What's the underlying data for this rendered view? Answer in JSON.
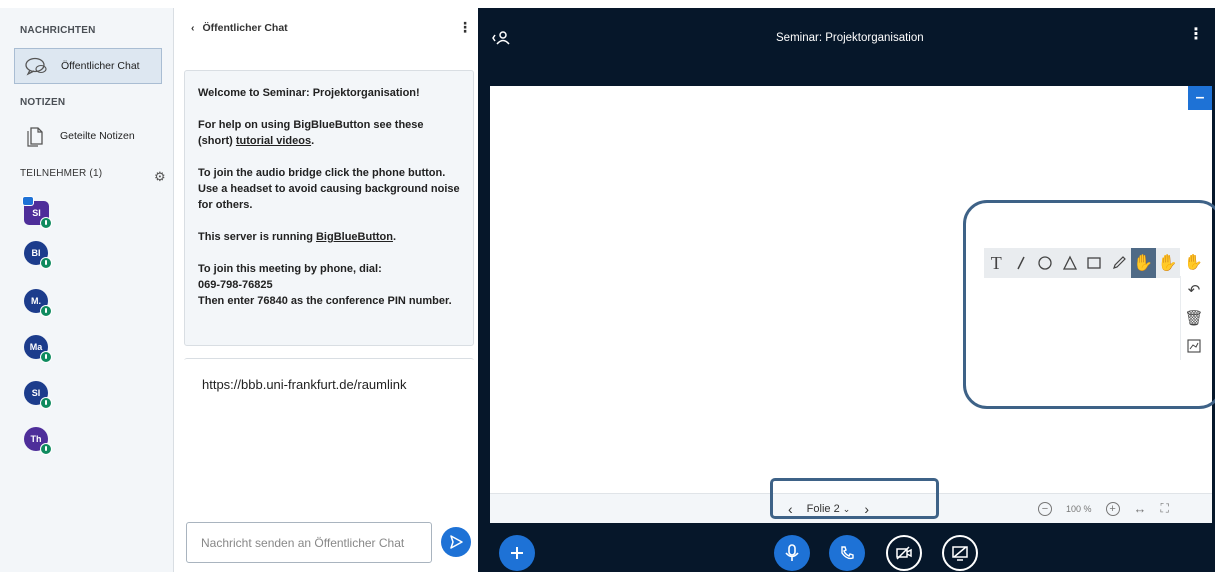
{
  "sidebar": {
    "messages_title": "NACHRICHTEN",
    "public_chat_label": "Öffentlicher Chat",
    "notes_title": "NOTIZEN",
    "shared_notes_label": "Geteilte Notizen",
    "participants_title": "TEILNEHMER (1)",
    "participants": [
      {
        "initials": "SI",
        "color": "#4e2e9a",
        "presenter": true
      },
      {
        "initials": "BI",
        "color": "#1c3c8c"
      },
      {
        "initials": "M.",
        "color": "#1c3c8c"
      },
      {
        "initials": "Ma",
        "color": "#1c3c8c"
      },
      {
        "initials": "SI",
        "color": "#1c3c8c"
      },
      {
        "initials": "Th",
        "color": "#4e2e9a"
      }
    ]
  },
  "chat": {
    "header_label": "Öffentlicher Chat",
    "welcome": {
      "line1": "Welcome to Seminar: Projektorganisation!",
      "help_prefix": "For help on using BigBlueButton see these (short) ",
      "help_link": "tutorial videos",
      "help_suffix": ".",
      "audio_text": "To join the audio bridge click the phone button. Use a headset to avoid causing background noise for others.",
      "server_prefix": "This server is running ",
      "server_link": "BigBlueButton",
      "server_suffix": ".",
      "phone_line1": "To join this meeting by phone, dial:",
      "phone_number": "069-798-76825",
      "phone_pin": "Then enter 76840 as the conference PIN number."
    },
    "room_link": "https://bbb.uni-frankfurt.de/raumlink",
    "input_placeholder": "Nachricht senden an Öffentlicher Chat"
  },
  "main": {
    "title": "Seminar: Projektorganisation",
    "slide_label": "Folie 2",
    "zoom_level": "100 %"
  },
  "colors": {
    "accent": "#1e72d6",
    "dark_background": "#06172a",
    "highlight_border": "#3e6287"
  }
}
